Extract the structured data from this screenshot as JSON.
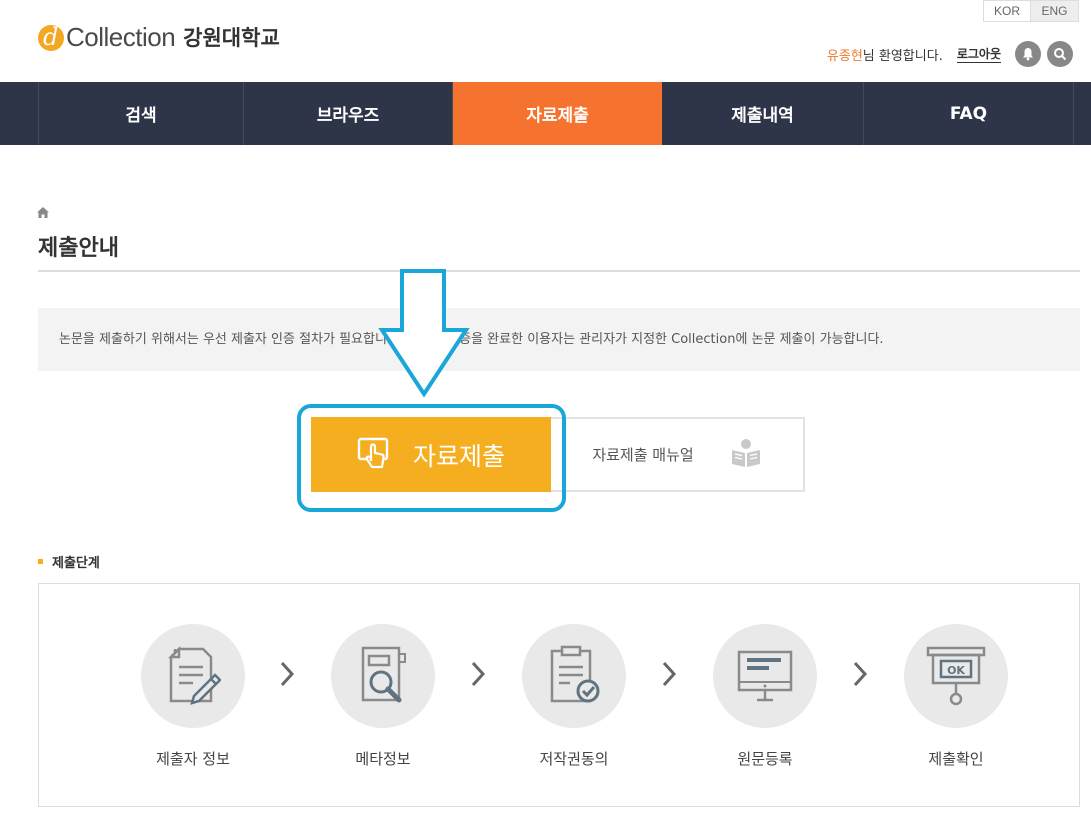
{
  "header": {
    "logo_text": "Collection",
    "univ": "강원대학교",
    "lang": {
      "kor": "KOR",
      "eng": "ENG"
    },
    "user": {
      "name": "유종현",
      "welcome": "님 환영합니다.",
      "logout": "로그아웃"
    },
    "icons": [
      "bell-icon",
      "search-icon"
    ]
  },
  "nav": [
    {
      "label": "검색"
    },
    {
      "label": "브라우즈"
    },
    {
      "label": "자료제출",
      "active": true
    },
    {
      "label": "제출내역"
    },
    {
      "label": "FAQ"
    }
  ],
  "page": {
    "title": "제출안내",
    "notice": "논문을 제출하기 위해서는 우선 제출자 인증 절차가 필요합니다. 제출자 인증을 완료한 이용자는 관리자가 지정한 Collection에 논문 제출이 가능합니다.",
    "submit_label": "자료제출",
    "manual_label": "자료제출 매뉴얼"
  },
  "steps_section": {
    "title": "제출단계",
    "steps": [
      {
        "label": "제출자 정보",
        "icon": "document-pen-icon"
      },
      {
        "label": "메타정보",
        "icon": "document-magnifier-icon"
      },
      {
        "label": "저작권동의",
        "icon": "clipboard-check-icon"
      },
      {
        "label": "원문등록",
        "icon": "monitor-icon"
      },
      {
        "label": "제출확인",
        "icon": "ok-sign-icon"
      }
    ]
  },
  "colors": {
    "nav_bg": "#2f3548",
    "nav_active": "#f5732e",
    "submit_bg": "#f5ae1f",
    "highlight": "#19a6d9"
  }
}
